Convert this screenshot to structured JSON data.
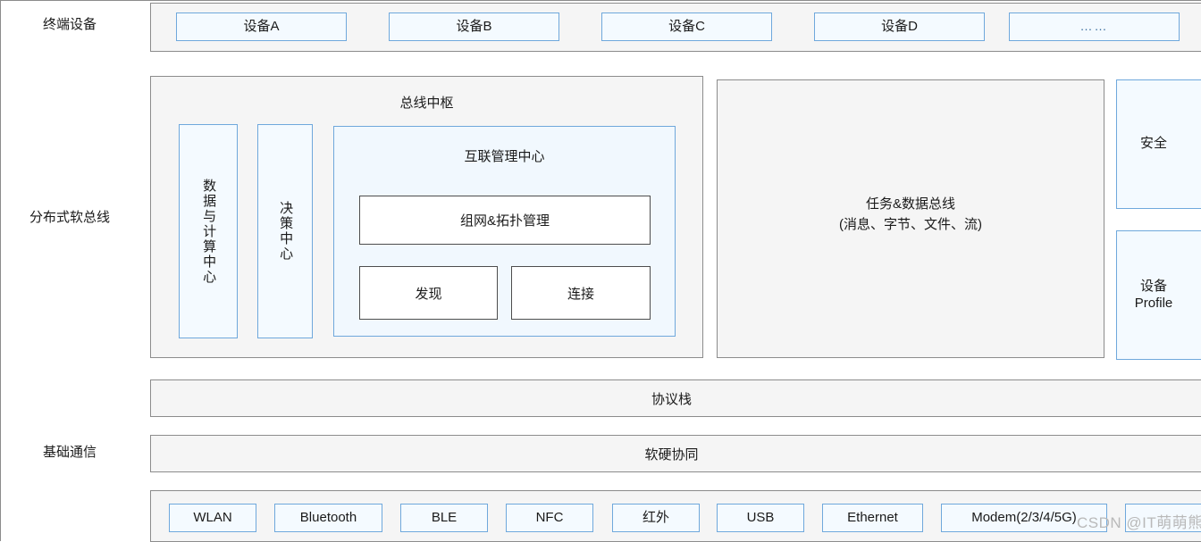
{
  "axis_labels": {
    "terminal": "终端设备",
    "soft_bus": "分布式软总线",
    "base_comm": "基础通信"
  },
  "terminal_row": {
    "devices": [
      {
        "label": "设备A"
      },
      {
        "label": "设备B"
      },
      {
        "label": "设备C"
      },
      {
        "label": "设备D"
      },
      {
        "label": "……"
      }
    ]
  },
  "bus_hub": {
    "title": "总线中枢",
    "data_compute_center": "数据与计算中心",
    "decision_center": "决策中心",
    "interconnect": {
      "title": "互联管理中心",
      "networking": "组网&拓扑管理",
      "discovery": "发现",
      "connection": "连接"
    }
  },
  "task_data_bus": {
    "line1": "任务&数据总线",
    "line2": "(消息、字节、文件、流)"
  },
  "right_column": {
    "security": "安全",
    "device_profile": "设备\nProfile"
  },
  "protocol_stack_bar": "协议栈",
  "hw_sw_bar": "软硬协同",
  "transports": [
    {
      "label": "WLAN"
    },
    {
      "label": "Bluetooth"
    },
    {
      "label": "BLE"
    },
    {
      "label": "NFC"
    },
    {
      "label": "红外"
    },
    {
      "label": "USB"
    },
    {
      "label": "Ethernet"
    },
    {
      "label": "Modem(2/3/4/5G)"
    },
    {
      "label": ""
    }
  ],
  "watermark": "CSDN @IT萌萌熊",
  "colors": {
    "chip_border": "#6fa8dc",
    "chip_fill": "#f4faff",
    "panel_fill": "#f5f5f5",
    "panel_border": "#8c8c8c",
    "box_border": "#4d4d4d",
    "text": "#1a1a1a",
    "watermark": "#b9b9b9"
  }
}
